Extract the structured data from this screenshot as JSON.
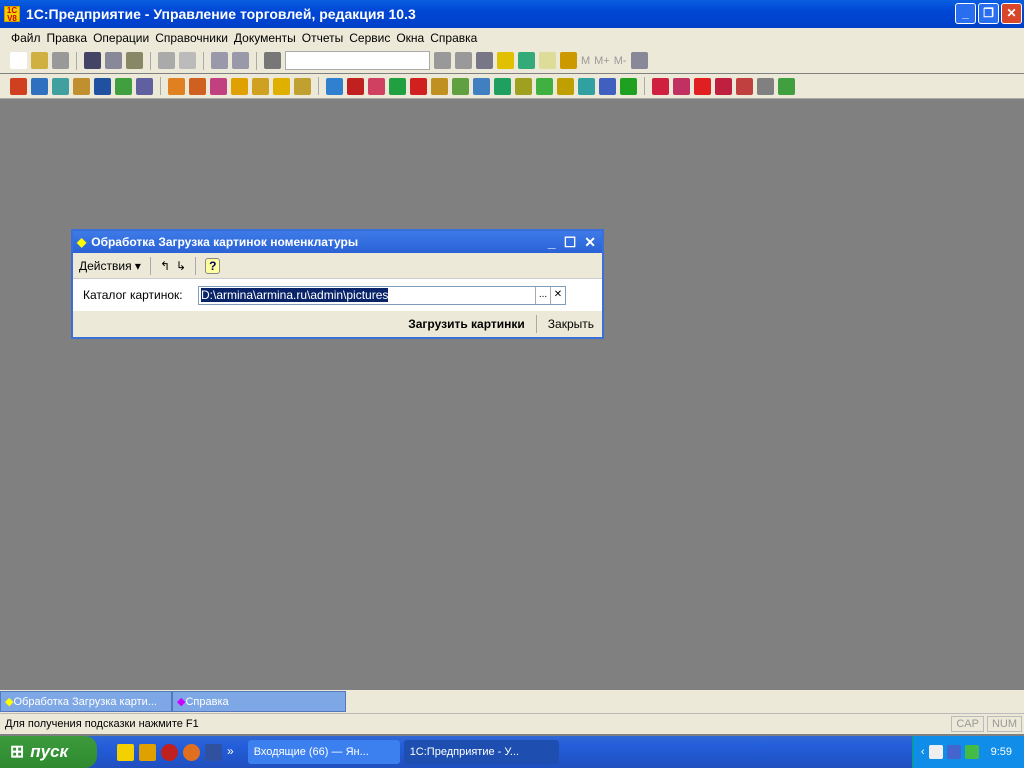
{
  "app": {
    "title": "1С:Предприятие - Управление торговлей, редакция 10.3",
    "logo": "1C V8"
  },
  "menu": [
    "Файл",
    "Правка",
    "Операции",
    "Справочники",
    "Документы",
    "Отчеты",
    "Сервис",
    "Окна",
    "Справка"
  ],
  "toolbar1": {
    "icons": [
      "new-icon",
      "open-icon",
      "save-icon",
      "cut-icon",
      "copy-icon",
      "paste-icon",
      "print-icon",
      "preview-icon",
      "undo-icon",
      "redo-icon",
      "find-icon"
    ],
    "search_value": "",
    "icons2": [
      "find-next-icon",
      "find-prev-icon",
      "windows-icon",
      "help-icon",
      "calculator-icon",
      "calendar-icon",
      "journal-icon"
    ],
    "memory": [
      "M",
      "M+",
      "M-"
    ]
  },
  "toolbar2": {
    "colors": [
      "#d04020",
      "#3070c0",
      "#40a0a0",
      "#c09030",
      "#2050a0",
      "#40a040",
      "#6060a0",
      "#e08020",
      "#d06020",
      "#c04080",
      "#e0a000",
      "#d0a020",
      "#e0b000",
      "#c0a030",
      "#3080d0",
      "#c02020",
      "#d04060",
      "#20a040",
      "#d02020",
      "#c09020",
      "#60a040",
      "#4080c0",
      "#20a060",
      "#a0a020",
      "#40b040",
      "#c0a000",
      "#30a0a0",
      "#4060c0",
      "#20a020",
      "#d02040",
      "#c03060",
      "#e02020",
      "#c02040",
      "#c04040",
      "#808080",
      "#40a040"
    ]
  },
  "dialog": {
    "title": "Обработка  Загрузка картинок номенклатуры",
    "actions_label": "Действия",
    "field_label": "Каталог картинок:",
    "field_value": "D:\\armina\\armina.ru\\admin\\pictures",
    "load_button": "Загрузить картинки",
    "close_button": "Закрыть"
  },
  "window_tabs": [
    "Обработка  Загрузка карти...",
    "Справка"
  ],
  "status": {
    "hint": "Для получения подсказки нажмите F1",
    "cap": "CAP",
    "num": "NUM"
  },
  "taskbar": {
    "start": "пуск",
    "tasks": [
      "Входящие (66) — Ян...",
      "1С:Предприятие - У..."
    ],
    "clock": "9:59"
  }
}
